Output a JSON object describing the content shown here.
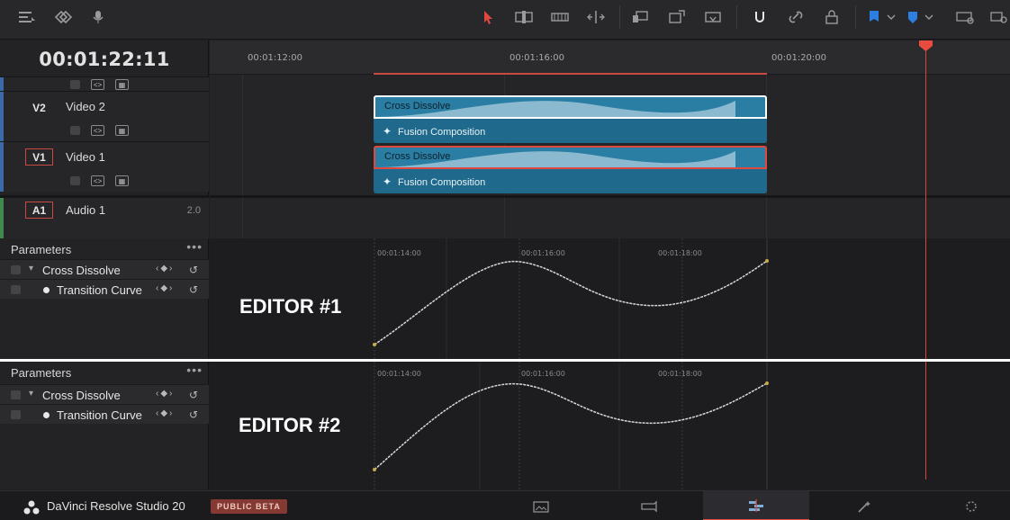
{
  "toolbar": {
    "left_icons": [
      "timeline-view-icon",
      "layers-icon",
      "voiceover-icon"
    ],
    "edit_icons": [
      "select-arrow-icon",
      "trim-icon",
      "blade-icon",
      "dynamic-trim-icon",
      "insert-icon",
      "overwrite-icon",
      "replace-icon",
      "snapping-icon",
      "link-icon",
      "lock-icon",
      "blue-flag-icon",
      "blue-marker-icon",
      "keyboard-icon",
      "zoom-icon"
    ],
    "accent": "#e0483d",
    "marker_color": "#2c7fe0"
  },
  "timecode": "00:01:22:11",
  "ruler": {
    "ticks": [
      "00:01:12:00",
      "00:01:16:00",
      "00:01:20:00"
    ]
  },
  "tracks": [
    {
      "id": "V2",
      "name": "Video 2",
      "armed": false
    },
    {
      "id": "V1",
      "name": "Video 1",
      "armed": true
    },
    {
      "id": "A1",
      "name": "Audio 1",
      "armed": true,
      "volume": "2.0"
    }
  ],
  "clips": {
    "v2_transition": "Cross Dissolve",
    "v2_composition": "Fusion Composition",
    "v1_transition": "Cross Dissolve",
    "v1_composition": "Fusion Composition",
    "clip_color": "#1f6a8c"
  },
  "editors": [
    {
      "title": "Parameters",
      "group": "Cross Dissolve",
      "param": "Transition Curve",
      "label": "EDITOR #1",
      "curve_ticks": [
        "00:01:14:00",
        "00:01:16:00",
        "00:01:18:00"
      ]
    },
    {
      "title": "Parameters",
      "group": "Cross Dissolve",
      "param": "Transition Curve",
      "label": "EDITOR #2",
      "curve_ticks": [
        "00:01:14:00",
        "00:01:16:00",
        "00:01:18:00"
      ]
    }
  ],
  "footer": {
    "app_name": "DaVinci Resolve Studio 20",
    "badge": "PUBLIC BETA",
    "pages": [
      "media-page-icon",
      "cut-page-icon",
      "edit-page-icon",
      "fusion-page-icon",
      "fairlight-page-icon"
    ],
    "active_page": "edit-page-icon"
  }
}
